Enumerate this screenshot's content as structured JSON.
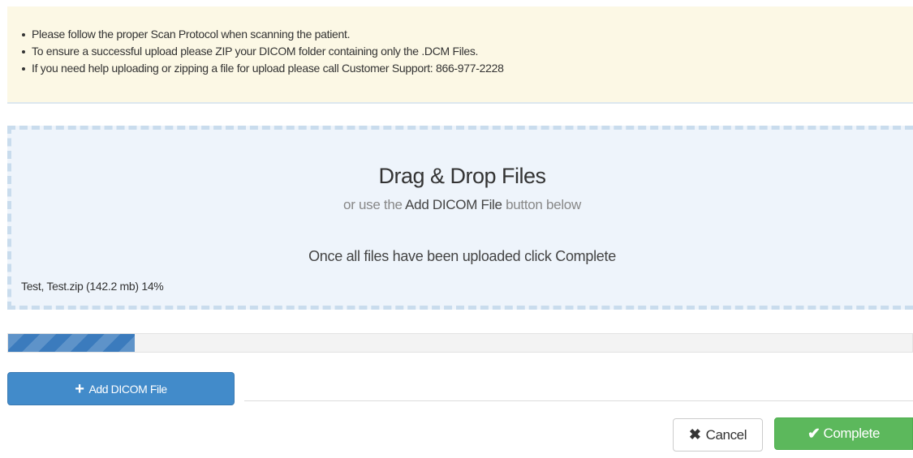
{
  "notice": {
    "items": [
      "Please follow the proper Scan Protocol when scanning the patient.",
      "To ensure a successful upload please ZIP your DICOM folder containing only the .DCM Files.",
      "If you need help uploading or zipping a file for upload please call Customer Support: 866-977-2228"
    ]
  },
  "dropzone": {
    "title": "Drag & Drop Files",
    "subtitle_prefix": "or use the ",
    "subtitle_emphasis": "Add DICOM File",
    "subtitle_suffix": " button below",
    "instruction": "Once all files have been uploaded click Complete",
    "file_info": "Test, Test.zip (142.2 mb) 14%"
  },
  "progress": {
    "percent": 14
  },
  "buttons": {
    "add_label": "Add DICOM File",
    "cancel_label": "Cancel",
    "complete_label": "Complete"
  },
  "icons": {
    "add": "plus-icon",
    "cancel": "times-icon",
    "complete": "check-icon"
  },
  "colors": {
    "primary": "#428bca",
    "success": "#5cb85c",
    "notice_bg": "#fcf8e5",
    "dropzone_bg": "#eef4fb",
    "progress_fill": "#3b7bbd"
  }
}
